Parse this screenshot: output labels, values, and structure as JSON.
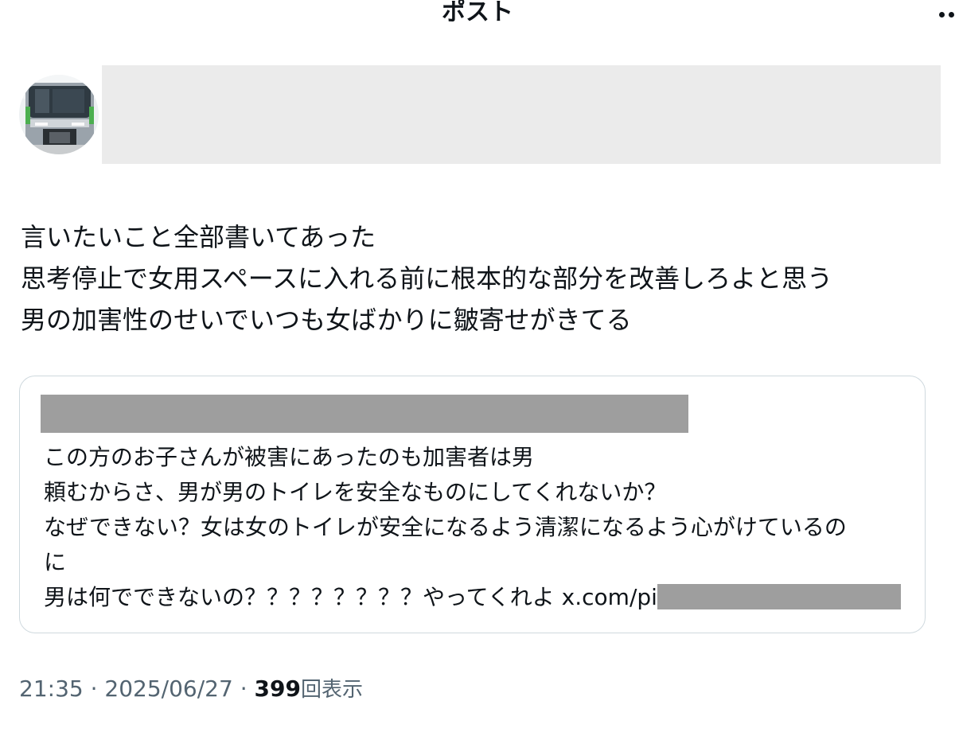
{
  "header": {
    "title": "ポスト"
  },
  "post": {
    "body_lines": [
      "言いたいこと全部書いてあった",
      "思考停止で女用スペースに入れる前に根本的な部分を改善しろよと思う",
      "男の加害性のせいでいつも女ばかりに皺寄せがきてる"
    ]
  },
  "quote": {
    "lines": [
      "この方のお子さんが被害にあったのも加害者は男",
      "頼むからさ、男が男のトイレを安全なものにしてくれないか？",
      "なぜできない？女は女のトイレが安全になるよう清潔になるよう心がけているの",
      "に"
    ],
    "last_line_text": "男は何でできないの？？？？？？？？やってくれよ ",
    "link_text": "x.com/pi"
  },
  "meta": {
    "time": "21:35",
    "separator": " · ",
    "date": "2025/06/27",
    "views_count": "399",
    "views_label": "回表示"
  },
  "icons": {
    "more": "more-horizontal-icon",
    "avatar_subject": "train"
  }
}
